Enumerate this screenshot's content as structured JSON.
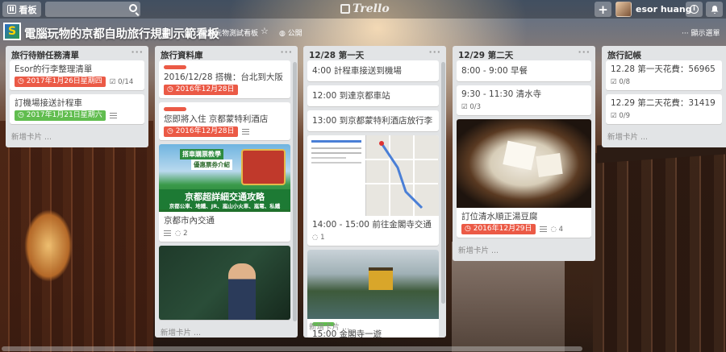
{
  "header": {
    "boards_label": "看板",
    "logo_text": "Trello",
    "user_name": "esor huang"
  },
  "board": {
    "title": "電腦玩物的京都自助旅行規劃示範看板",
    "team": "電腦玩物測試看板",
    "visibility": "公開",
    "menu_label": "顯示選單"
  },
  "lists": [
    {
      "title": "旅行待辦任務清單",
      "cards": [
        {
          "title": "Esor的行李整理清單",
          "due": "2017年1月26日星期四",
          "checklist": "0/14"
        },
        {
          "title": "訂機場接送計程車",
          "due": "2017年1月21日星期六"
        }
      ],
      "add_card": "新增卡片 ..."
    },
    {
      "title": "旅行資料庫",
      "cards": [
        {
          "title": "2016/12/28 搭機：台北到大阪",
          "due": "2016年12月28日"
        },
        {
          "title": "您即將入住 京都蒙特利酒店",
          "due": "2016年12月28日"
        },
        {
          "title": "京都市內交通",
          "comments": "2",
          "cover": {
            "tag": "搭車購票教學",
            "tag2": "優惠票券介紹",
            "headline": "京都超詳細交通攻略",
            "sub": "京都公車、地鐵、JR、嵐山小火車、嵐電、私鐵"
          }
        },
        {
          "title": ""
        }
      ],
      "add_card": "新增卡片 ..."
    },
    {
      "title": "12/28 第一天",
      "cards": [
        {
          "title": "4:00 計程車接送到機場"
        },
        {
          "title": "12:00 到達京都車站"
        },
        {
          "title": "13:00 到京都蒙特利酒店放行李"
        },
        {
          "title": "14:00 - 15:00 前往金閣寺交通",
          "comments": "1"
        },
        {
          "title": "15:00 金閣寺一遊"
        }
      ],
      "add_card": "新增卡片 ..."
    },
    {
      "title": "12/29 第二天",
      "cards": [
        {
          "title": "8:00 - 9:00 早餐"
        },
        {
          "title": "9:30 - 11:30 清水寺",
          "checklist": "0/3"
        },
        {
          "title": "訂位清水順正湯豆腐",
          "due": "2016年12月29日",
          "comments": "4"
        }
      ],
      "add_card": "新增卡片 ..."
    },
    {
      "title": "旅行記帳",
      "cards": [
        {
          "title": "12.28 第一天花費：56965",
          "checklist": "0/8"
        },
        {
          "title": "12.29 第二天花費：31419",
          "checklist": "0/9"
        }
      ],
      "add_card": "新增卡片 ..."
    }
  ],
  "colors": {
    "label_red": "#eb5a46",
    "label_green": "#61bd4f",
    "list_bg": "#e2e4e6"
  }
}
